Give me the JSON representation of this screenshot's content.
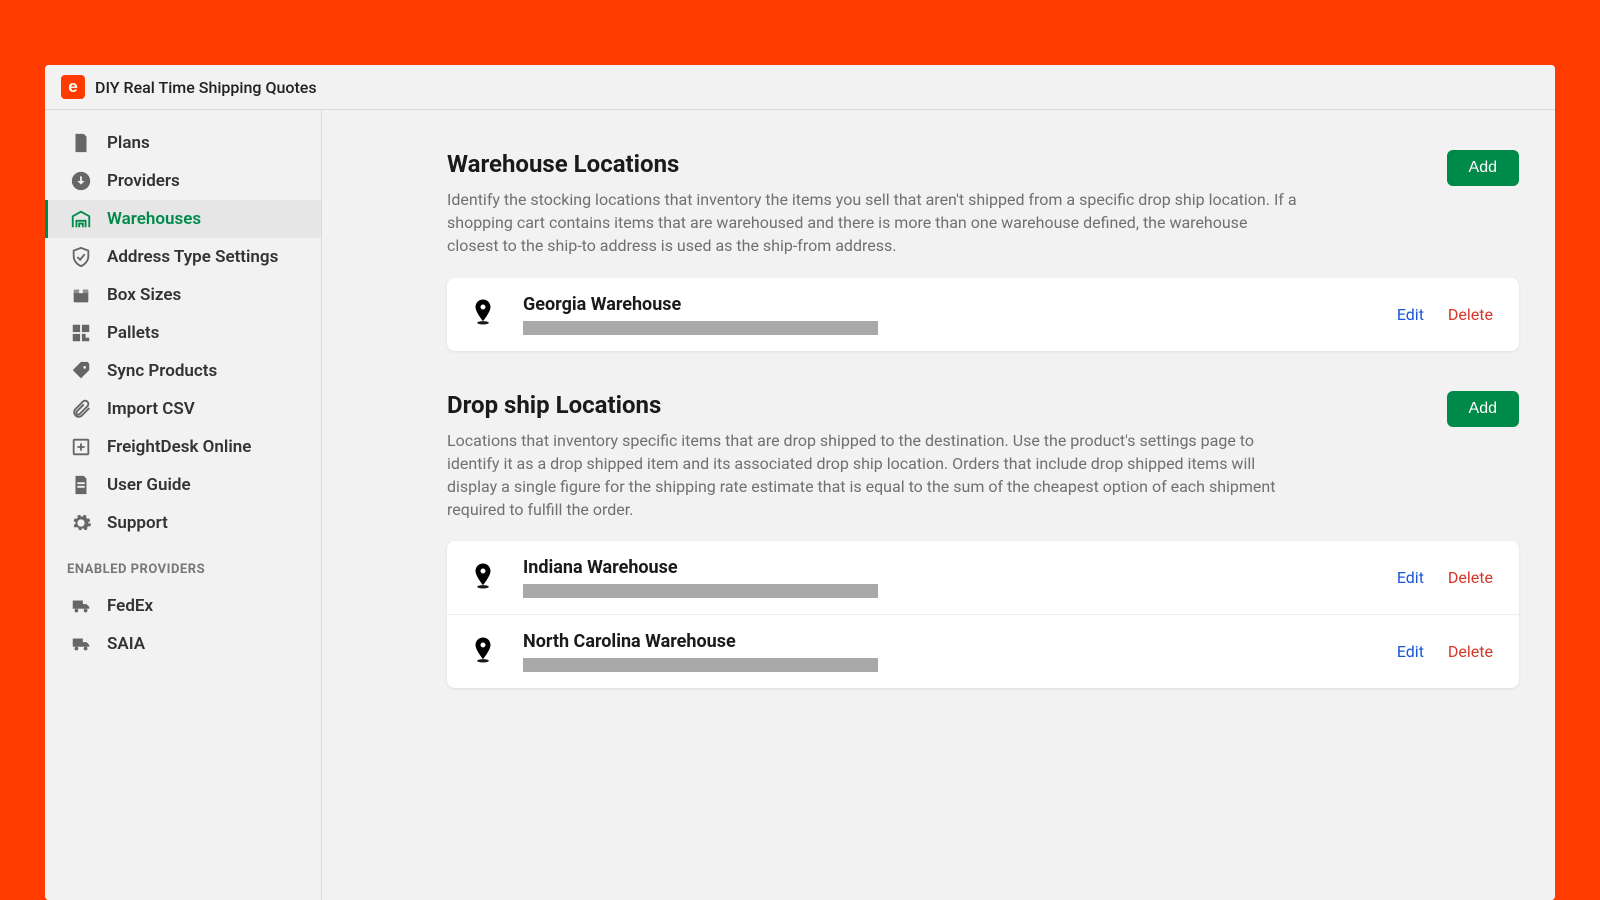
{
  "app": {
    "title": "DIY Real Time Shipping Quotes"
  },
  "sidebar": {
    "items": [
      {
        "label": "Plans"
      },
      {
        "label": "Providers"
      },
      {
        "label": "Warehouses"
      },
      {
        "label": "Address Type Settings"
      },
      {
        "label": "Box Sizes"
      },
      {
        "label": "Pallets"
      },
      {
        "label": "Sync Products"
      },
      {
        "label": "Import CSV"
      },
      {
        "label": "FreightDesk Online"
      },
      {
        "label": "User Guide"
      },
      {
        "label": "Support"
      }
    ],
    "enabled_label": "ENABLED PROVIDERS",
    "enabled_providers": [
      {
        "label": "FedEx"
      },
      {
        "label": "SAIA"
      }
    ]
  },
  "main": {
    "add_label": "Add",
    "edit_label": "Edit",
    "delete_label": "Delete",
    "warehouse": {
      "title": "Warehouse Locations",
      "desc": "Identify the stocking locations that inventory the items you sell that aren't shipped from a specific drop ship location. If a shopping cart contains items that are warehoused and there is more than one warehouse defined, the warehouse closest to the ship-to address is used as the ship-from address.",
      "items": [
        {
          "name": "Georgia Warehouse"
        }
      ]
    },
    "dropship": {
      "title": "Drop ship Locations",
      "desc": "Locations that inventory specific items that are drop shipped to the destination. Use the product's settings page to identify it as a drop shipped item and its associated drop ship location. Orders that include drop shipped items will display a single figure for the shipping rate estimate that is equal to the sum of the cheapest option of each shipment required to fulfill the order.",
      "items": [
        {
          "name": "Indiana Warehouse"
        },
        {
          "name": "North Carolina Warehouse"
        }
      ]
    }
  }
}
